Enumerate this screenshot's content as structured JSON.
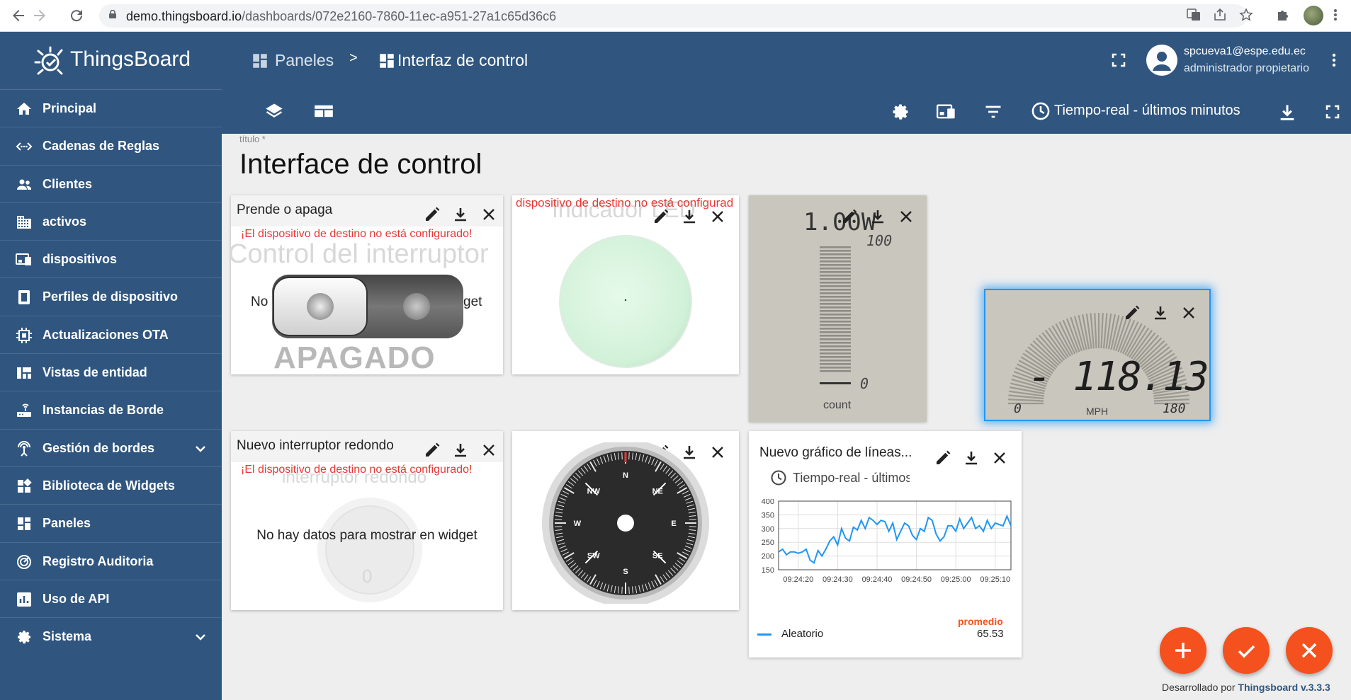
{
  "browser": {
    "url_host": "demo.thingsboard.io",
    "url_path": "/dashboards/072e2160-7860-11ec-a951-27a1c65d36c6"
  },
  "brand": {
    "name": "ThingsBoard"
  },
  "sidebar": {
    "items": [
      {
        "label": "Principal",
        "icon": "home-icon"
      },
      {
        "label": "Cadenas de Reglas",
        "icon": "rule-chain-icon"
      },
      {
        "label": "Clientes",
        "icon": "people-icon"
      },
      {
        "label": "activos",
        "icon": "domain-icon"
      },
      {
        "label": "dispositivos",
        "icon": "devices-icon"
      },
      {
        "label": "Perfiles de dispositivo",
        "icon": "profile-icon"
      },
      {
        "label": "Actualizaciones OTA",
        "icon": "memory-icon"
      },
      {
        "label": "Vistas de entidad",
        "icon": "view-quilt-icon"
      },
      {
        "label": "Instancias de Borde",
        "icon": "router-icon"
      },
      {
        "label": "Gestión de bordes",
        "icon": "settings-input-antenna-icon",
        "expandable": true
      },
      {
        "label": "Biblioteca de Widgets",
        "icon": "widgets-icon"
      },
      {
        "label": "Paneles",
        "icon": "dashboard-icon"
      },
      {
        "label": "Registro Auditoria",
        "icon": "track-changes-icon"
      },
      {
        "label": "Uso de API",
        "icon": "insert-chart-icon"
      },
      {
        "label": "Sistema",
        "icon": "settings-icon",
        "expandable": true
      }
    ]
  },
  "header": {
    "crumb_parent": "Paneles",
    "crumb_separator": ">",
    "crumb_current": "Interfaz de control",
    "user_email": "spcueva1@espe.edu.ec",
    "user_role": "administrador propietario",
    "timewindow": "Tiempo-real - últimos minutos"
  },
  "dashboard": {
    "title_caption": "título *",
    "title": "Interface de control"
  },
  "widgets": {
    "switch": {
      "title": "Prende o apaga",
      "error": "¡El dispositivo de destino no está configurado!",
      "ghost_title": "Control del interruptor",
      "left_label": "No",
      "right_label": "get",
      "state": "APAGADO"
    },
    "led": {
      "error": "dispositivo de destino no está configurad",
      "ghost_title": "Indicador LED"
    },
    "lcd_bar": {
      "value": "1.00W",
      "max": "100",
      "min": "0",
      "label": "count"
    },
    "lcd_speed": {
      "value": "- 118.13",
      "min": "0",
      "max": "180",
      "unit": "MPH"
    },
    "round_switch": {
      "title": "Nuevo interruptor redondo",
      "error": "¡El dispositivo de destino no está configurado!",
      "ghost_title": "interruptor redondo",
      "no_data": "No hay datos para mostrar en widget",
      "ghost_value": "0"
    },
    "compass": {
      "directions": [
        "N",
        "NE",
        "E",
        "SE",
        "S",
        "SW",
        "W",
        "NW"
      ]
    },
    "line_chart": {
      "title": "Nuevo gráfico de líneas...",
      "timewindow": "Tiempo-real - últimos mir",
      "stat_header": "promedio",
      "series_name": "Aleatorio",
      "series_value": "65.53",
      "series_color": "#2196f3"
    }
  },
  "chart_data": {
    "type": "line",
    "x": [
      "09:24:15",
      "09:24:16",
      "09:24:17",
      "09:24:18",
      "09:24:19",
      "09:24:20",
      "09:24:21",
      "09:24:22",
      "09:24:23",
      "09:24:24",
      "09:24:25",
      "09:24:26",
      "09:24:27",
      "09:24:28",
      "09:24:29",
      "09:24:30",
      "09:24:31",
      "09:24:32",
      "09:24:33",
      "09:24:34",
      "09:24:35",
      "09:24:36",
      "09:24:37",
      "09:24:38",
      "09:24:39",
      "09:24:40",
      "09:24:41",
      "09:24:42",
      "09:24:43",
      "09:24:44",
      "09:24:45",
      "09:24:46",
      "09:24:47",
      "09:24:48",
      "09:24:49",
      "09:24:50",
      "09:24:51",
      "09:24:52",
      "09:24:53",
      "09:24:54",
      "09:24:55",
      "09:24:56",
      "09:24:57",
      "09:24:58",
      "09:24:59",
      "09:25:00",
      "09:25:01",
      "09:25:02",
      "09:25:03",
      "09:25:04",
      "09:25:05",
      "09:25:06",
      "09:25:07",
      "09:25:08",
      "09:25:09",
      "09:25:10",
      "09:25:11",
      "09:25:12",
      "09:25:13",
      "09:25:14"
    ],
    "series": [
      {
        "name": "Aleatorio",
        "values": [
          215,
          225,
          205,
          215,
          215,
          210,
          215,
          225,
          185,
          175,
          220,
          200,
          225,
          255,
          270,
          240,
          300,
          265,
          255,
          305,
          295,
          330,
          300,
          340,
          330,
          315,
          330,
          325,
          290,
          320,
          260,
          290,
          320,
          310,
          275,
          260,
          300,
          290,
          340,
          330,
          280,
          255,
          270,
          310,
          310,
          290,
          335,
          300,
          320,
          340,
          300,
          310,
          290,
          330,
          300,
          320,
          315,
          310,
          345,
          310
        ]
      }
    ],
    "xticks": [
      "09:24:20",
      "09:24:30",
      "09:24:40",
      "09:24:50",
      "09:25:00",
      "09:25:10"
    ],
    "yticks": [
      150,
      200,
      250,
      300,
      350,
      400
    ],
    "ylim": [
      150,
      400
    ],
    "grid": true,
    "title": "",
    "xlabel": "",
    "ylabel": ""
  },
  "fabs": {
    "add": "+",
    "apply": "check",
    "cancel": "close"
  },
  "footer": {
    "prefix": "Desarrollado por",
    "link": "Thingsboard v.3.3.3"
  }
}
